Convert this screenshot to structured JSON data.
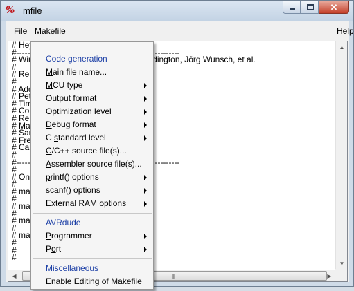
{
  "window": {
    "title": "mfile",
    "app_icon": "%",
    "caption_buttons": {
      "minimize": "minimize-icon",
      "maximize": "maximize-icon",
      "close": "✕"
    }
  },
  "menubar": {
    "file": "File",
    "makefile": "Makefile",
    "help": "Help"
  },
  "editor": {
    "lines": [
      "# Hey",
      "#-----------------------------------------------------------",
      "# Win                                        B. Weddington, Jörg Wunsch, et al.",
      "#",
      "# Rel",
      "#",
      "# Add                                       tten by:",
      "# Pet",
      "# Tim",
      "# Coli",
      "# Rei",
      "# Mar",
      "# San",
      "# Free",
      "# Car",
      "#",
      "#-----------------------------------------------------------",
      "#",
      "# On",
      "#",
      "# mak",
      "#",
      "# mak",
      "#",
      "# mak",
      "#",
      "# mak",
      "#",
      "#",
      "#"
    ]
  },
  "makefile_menu": {
    "code_generation_header": "Code generation",
    "items": [
      {
        "pre": "",
        "u": "M",
        "post": "ain file name...",
        "submenu": false
      },
      {
        "pre": "",
        "u": "M",
        "post": "CU type",
        "submenu": true
      },
      {
        "pre": "Output ",
        "u": "f",
        "post": "ormat",
        "submenu": true
      },
      {
        "pre": "",
        "u": "O",
        "post": "ptimization level",
        "submenu": true
      },
      {
        "pre": "",
        "u": "D",
        "post": "ebug format",
        "submenu": true
      },
      {
        "pre": "C ",
        "u": "s",
        "post": "tandard level",
        "submenu": true
      },
      {
        "pre": "",
        "u": "C",
        "post": "/C++ source file(s)...",
        "submenu": false
      },
      {
        "pre": "",
        "u": "A",
        "post": "ssembler source file(s)...",
        "submenu": false
      },
      {
        "pre": "",
        "u": "p",
        "post": "rintf() options",
        "submenu": true
      },
      {
        "pre": "sca",
        "u": "n",
        "post": "f() options",
        "submenu": true
      },
      {
        "pre": "",
        "u": "E",
        "post": "xternal RAM options",
        "submenu": true
      }
    ],
    "avrdude_header": "AVRdude",
    "avrdude_items": [
      {
        "pre": "",
        "u": "P",
        "post": "rogrammer",
        "submenu": true
      },
      {
        "pre": "P",
        "u": "o",
        "post": "rt",
        "submenu": true
      }
    ],
    "misc_header": "Miscellaneous",
    "misc_items": [
      {
        "pre": "Enable Editing of Makefile",
        "u": "",
        "post": "",
        "submenu": false
      }
    ]
  },
  "colors": {
    "header_text": "#1c3fa6",
    "window_border": "#6e7f92",
    "close_button": "#c4402a"
  }
}
